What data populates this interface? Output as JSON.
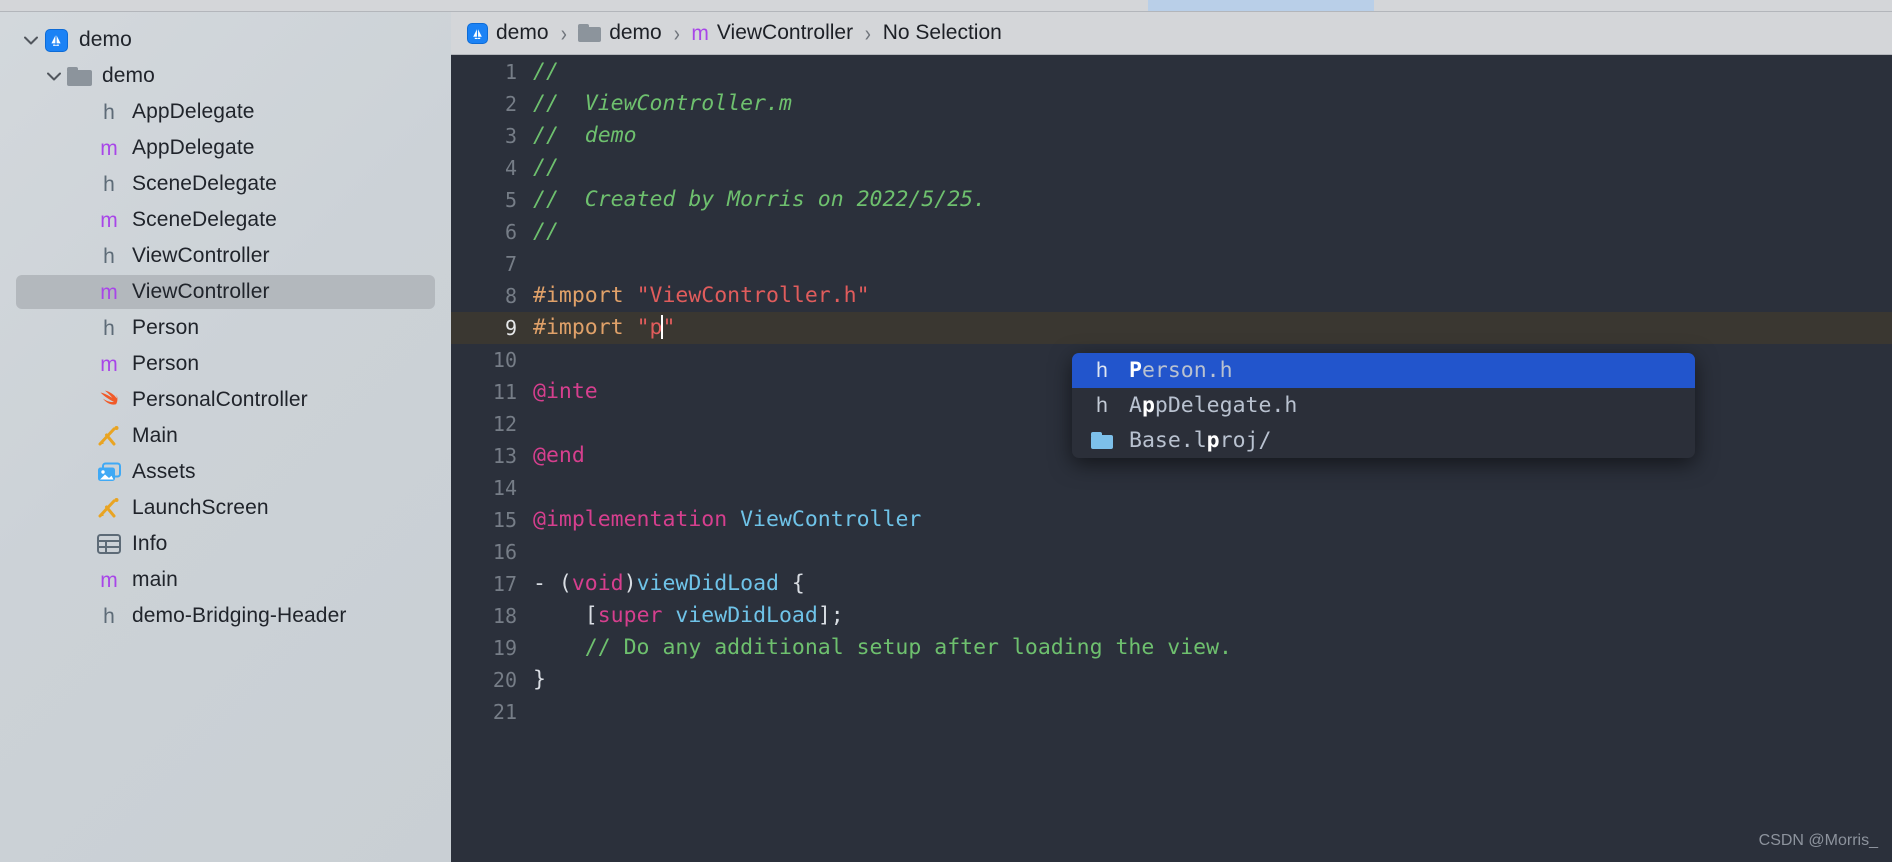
{
  "window": {
    "tabstrip": {
      "active_tab_present": true
    }
  },
  "sidebar": {
    "items": [
      {
        "label": "demo",
        "icon": "app-icon",
        "kind": "project",
        "depth": 0,
        "disclosure": "expanded",
        "selected": false
      },
      {
        "label": "demo",
        "icon": "folder-icon",
        "kind": "group",
        "depth": 1,
        "disclosure": "expanded",
        "selected": false
      },
      {
        "label": "AppDelegate",
        "icon": "header-file-icon",
        "kind": "h",
        "depth": 2,
        "disclosure": "none",
        "selected": false
      },
      {
        "label": "AppDelegate",
        "icon": "objc-file-icon",
        "kind": "m",
        "depth": 2,
        "disclosure": "none",
        "selected": false
      },
      {
        "label": "SceneDelegate",
        "icon": "header-file-icon",
        "kind": "h",
        "depth": 2,
        "disclosure": "none",
        "selected": false
      },
      {
        "label": "SceneDelegate",
        "icon": "objc-file-icon",
        "kind": "m",
        "depth": 2,
        "disclosure": "none",
        "selected": false
      },
      {
        "label": "ViewController",
        "icon": "header-file-icon",
        "kind": "h",
        "depth": 2,
        "disclosure": "none",
        "selected": false
      },
      {
        "label": "ViewController",
        "icon": "objc-file-icon",
        "kind": "m",
        "depth": 2,
        "disclosure": "none",
        "selected": true
      },
      {
        "label": "Person",
        "icon": "header-file-icon",
        "kind": "h",
        "depth": 2,
        "disclosure": "none",
        "selected": false
      },
      {
        "label": "Person",
        "icon": "objc-file-icon",
        "kind": "m",
        "depth": 2,
        "disclosure": "none",
        "selected": false
      },
      {
        "label": "PersonalController",
        "icon": "swift-file-icon",
        "kind": "swift",
        "depth": 2,
        "disclosure": "none",
        "selected": false
      },
      {
        "label": "Main",
        "icon": "storyboard-icon",
        "kind": "storyboard",
        "depth": 2,
        "disclosure": "none",
        "selected": false
      },
      {
        "label": "Assets",
        "icon": "assets-catalog-icon",
        "kind": "assets",
        "depth": 2,
        "disclosure": "none",
        "selected": false
      },
      {
        "label": "LaunchScreen",
        "icon": "storyboard-icon",
        "kind": "storyboard",
        "depth": 2,
        "disclosure": "none",
        "selected": false
      },
      {
        "label": "Info",
        "icon": "plist-icon",
        "kind": "plist",
        "depth": 2,
        "disclosure": "none",
        "selected": false
      },
      {
        "label": "main",
        "icon": "objc-file-icon",
        "kind": "m",
        "depth": 2,
        "disclosure": "none",
        "selected": false
      },
      {
        "label": "demo-Bridging-Header",
        "icon": "header-file-icon",
        "kind": "h",
        "depth": 2,
        "disclosure": "none",
        "selected": false
      }
    ]
  },
  "breadcrumb": {
    "separator": "›",
    "items": [
      {
        "label": "demo",
        "icon": "app-icon"
      },
      {
        "label": "demo",
        "icon": "folder-icon"
      },
      {
        "label": "ViewController",
        "icon": "objc-file-icon"
      },
      {
        "label": "No Selection",
        "icon": "none"
      }
    ]
  },
  "editor": {
    "current_line": 9,
    "lines": [
      {
        "n": "1",
        "tokens": [
          {
            "t": "//",
            "c": "c-comment"
          }
        ]
      },
      {
        "n": "2",
        "tokens": [
          {
            "t": "//  ViewController.m",
            "c": "c-comment"
          }
        ]
      },
      {
        "n": "3",
        "tokens": [
          {
            "t": "//  demo",
            "c": "c-comment"
          }
        ]
      },
      {
        "n": "4",
        "tokens": [
          {
            "t": "//",
            "c": "c-comment"
          }
        ]
      },
      {
        "n": "5",
        "tokens": [
          {
            "t": "//  Created by Morris on 2022/5/25.",
            "c": "c-comment"
          }
        ]
      },
      {
        "n": "6",
        "tokens": [
          {
            "t": "//",
            "c": "c-comment"
          }
        ]
      },
      {
        "n": "7",
        "tokens": []
      },
      {
        "n": "8",
        "tokens": [
          {
            "t": "#import ",
            "c": "c-pre"
          },
          {
            "t": "\"ViewController.h\"",
            "c": "c-str"
          }
        ]
      },
      {
        "n": "9",
        "tokens": [
          {
            "t": "#import ",
            "c": "c-pre"
          },
          {
            "t": "\"p",
            "c": "c-str"
          },
          {
            "t": "|CARET|",
            "c": "caret"
          },
          {
            "t": "\"",
            "c": "c-str"
          }
        ]
      },
      {
        "n": "10",
        "tokens": []
      },
      {
        "n": "11",
        "tokens": [
          {
            "t": "@inte",
            "c": "c-key"
          }
        ]
      },
      {
        "n": "12",
        "tokens": []
      },
      {
        "n": "13",
        "tokens": [
          {
            "t": "@end",
            "c": "c-key"
          }
        ]
      },
      {
        "n": "14",
        "tokens": []
      },
      {
        "n": "15",
        "tokens": [
          {
            "t": "@implementation ",
            "c": "c-key"
          },
          {
            "t": "ViewController",
            "c": "c-type"
          }
        ]
      },
      {
        "n": "16",
        "tokens": []
      },
      {
        "n": "17",
        "tokens": [
          {
            "t": "- (",
            "c": "c-plain"
          },
          {
            "t": "void",
            "c": "c-key"
          },
          {
            "t": ")",
            "c": "c-plain"
          },
          {
            "t": "viewDidLoad",
            "c": "c-fn"
          },
          {
            "t": " {",
            "c": "c-plain"
          }
        ]
      },
      {
        "n": "18",
        "tokens": [
          {
            "t": "    [",
            "c": "c-plain"
          },
          {
            "t": "super",
            "c": "c-key"
          },
          {
            "t": " ",
            "c": "c-plain"
          },
          {
            "t": "viewDidLoad",
            "c": "c-fn"
          },
          {
            "t": "];",
            "c": "c-plain"
          }
        ]
      },
      {
        "n": "19",
        "tokens": [
          {
            "t": "    // Do any additional setup after loading the view.",
            "c": "c-comment2"
          }
        ]
      },
      {
        "n": "20",
        "tokens": [
          {
            "t": "}",
            "c": "c-plain"
          }
        ]
      },
      {
        "n": "21",
        "tokens": []
      }
    ]
  },
  "autocomplete": {
    "items": [
      {
        "icon": "header-file-icon",
        "prefix": "",
        "match": "P",
        "suffix": "erson.h",
        "selected": true
      },
      {
        "icon": "header-file-icon",
        "prefix": "A",
        "match": "p",
        "suffix": "pDelegate.h",
        "selected": false
      },
      {
        "icon": "folder-icon-blue",
        "prefix": "Base.l",
        "match": "p",
        "suffix": "roj/",
        "selected": false
      }
    ]
  },
  "watermark": {
    "text": "CSDN @Morris_"
  },
  "colors": {
    "accent_selection": "#2255cc",
    "sidebar_selected": "#b3b8bd",
    "editor_bg": "#2b303b",
    "current_line_bg": "#3a3731",
    "comment": "#6ec06e",
    "string": "#e05c5c",
    "preprocessor": "#e0a169",
    "keyword": "#d63f8e",
    "type": "#6fc3e8"
  }
}
